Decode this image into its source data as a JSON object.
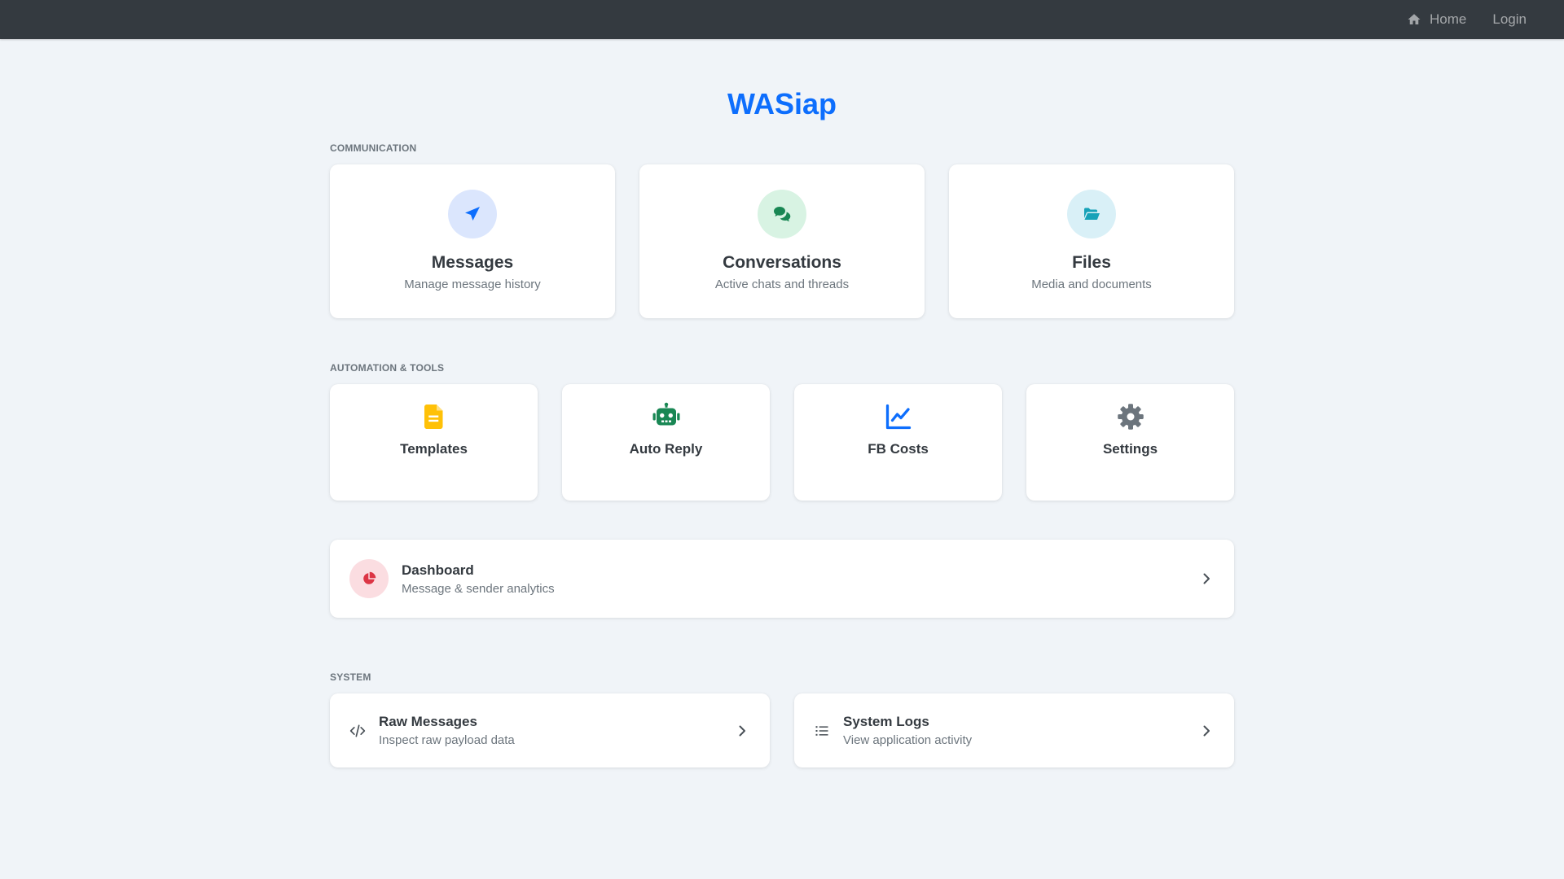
{
  "navbar": {
    "home_label": "Home",
    "login_label": "Login",
    "icons": {
      "home": "home-icon"
    }
  },
  "app": {
    "title": "WASiap"
  },
  "sections": {
    "communication": "COMMUNICATION",
    "automation": "AUTOMATION & TOOLS",
    "system": "SYSTEM"
  },
  "communication": [
    {
      "title": "Messages",
      "subtitle": "Manage message history",
      "icon": "paper-plane-icon",
      "color": "#0d6efd",
      "bg": "#dbe6fd"
    },
    {
      "title": "Conversations",
      "subtitle": "Active chats and threads",
      "icon": "chat-bubbles-icon",
      "color": "#198754",
      "bg": "#d8f3e3"
    },
    {
      "title": "Files",
      "subtitle": "Media and documents",
      "icon": "folder-open-icon",
      "color": "#17a2b8",
      "bg": "#d9f0f7"
    }
  ],
  "tools": [
    {
      "title": "Templates",
      "icon": "document-icon",
      "color": "#ffc107"
    },
    {
      "title": "Auto Reply",
      "icon": "robot-icon",
      "color": "#198754"
    },
    {
      "title": "FB Costs",
      "icon": "line-chart-icon",
      "color": "#0d6efd"
    },
    {
      "title": "Settings",
      "icon": "gear-icon",
      "color": "#6c757d"
    }
  ],
  "dashboard": {
    "title": "Dashboard",
    "subtitle": "Message & sender analytics",
    "icon": "pie-chart-icon",
    "color": "#dc3545"
  },
  "system": [
    {
      "title": "Raw Messages",
      "subtitle": "Inspect raw payload data",
      "icon": "code-icon"
    },
    {
      "title": "System Logs",
      "subtitle": "View application activity",
      "icon": "list-icon"
    }
  ]
}
